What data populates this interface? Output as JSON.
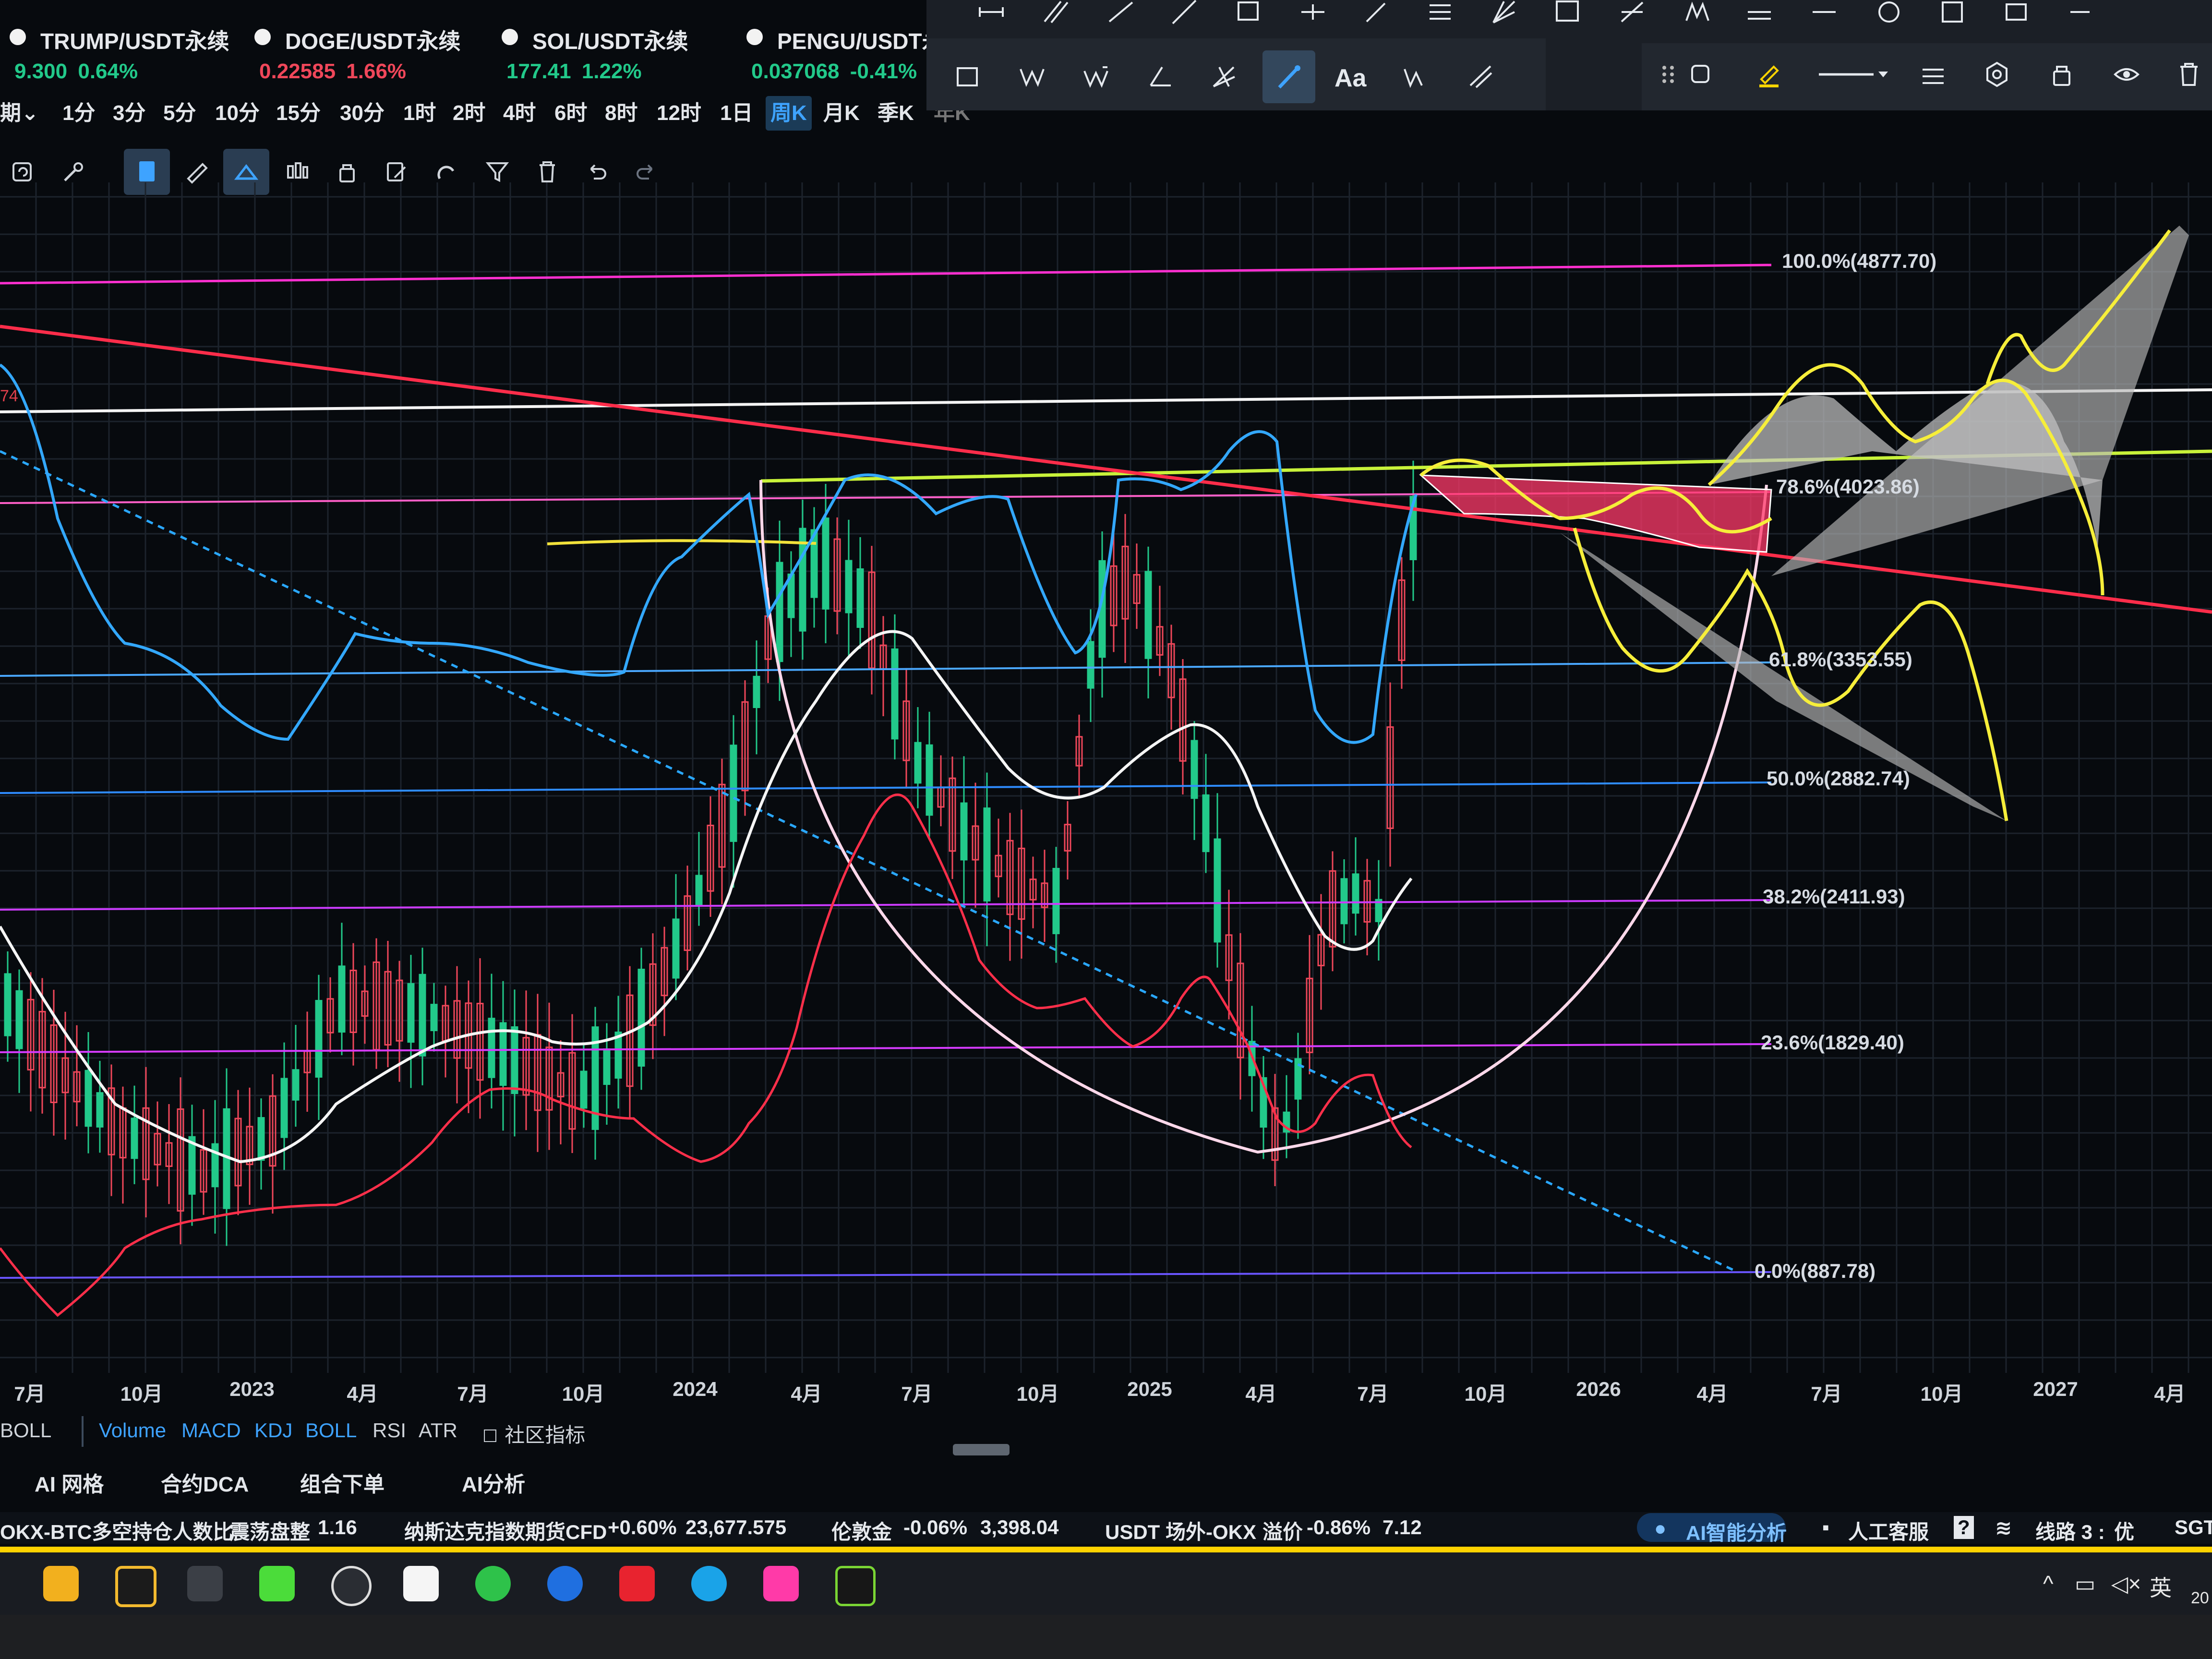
{
  "tickers": [
    {
      "name": "TRUMP/USDT永续",
      "price": "9.300",
      "change": "0.64%",
      "dir": "up"
    },
    {
      "name": "DOGE/USDT永续",
      "price": "0.22585",
      "change": "1.66%",
      "dir": "down"
    },
    {
      "name": "SOL/USDT永续",
      "price": "177.41",
      "change": "1.22%",
      "dir": "up"
    },
    {
      "name": "PENGU/USDT永",
      "price": "0.037068",
      "change": "-0.41%",
      "dir": "up"
    }
  ],
  "timeframes": [
    "期⌄",
    "1分",
    "3分",
    "5分",
    "10分",
    "15分",
    "30分",
    "1时",
    "2时",
    "4时",
    "6时",
    "8时",
    "12时",
    "1日",
    "周K",
    "月K",
    "季K",
    "年K"
  ],
  "active_timeframe": "周K",
  "corner_value": "74",
  "fib_levels": [
    {
      "label": "100.0%(4877.70)",
      "color": "#ff2fd0"
    },
    {
      "label": "78.6%(4023.86)",
      "color": "#ff5fc8"
    },
    {
      "label": "61.8%(3353.55)",
      "color": "#4aa8ff"
    },
    {
      "label": "50.0%(2882.74)",
      "color": "#2f8cff"
    },
    {
      "label": "38.2%(2411.93)",
      "color": "#cc3bff"
    },
    {
      "label": "23.6%(1829.40)",
      "color": "#d63bff"
    },
    {
      "label": "0.0%(887.78)",
      "color": "#6a55ff"
    }
  ],
  "x_axis": [
    "7月",
    "10月",
    "2023",
    "4月",
    "7月",
    "10月",
    "2024",
    "4月",
    "7月",
    "10月",
    "2025",
    "4月",
    "7月",
    "10月",
    "2026",
    "4月",
    "7月",
    "10月",
    "2027",
    "4月"
  ],
  "indicators": {
    "current": "BOLL",
    "tabs": [
      "Volume",
      "MACD",
      "KDJ",
      "BOLL",
      "RSI",
      "ATR"
    ],
    "community": "社区指标"
  },
  "features": [
    "AI 网格",
    "合约DCA",
    "组合下单",
    "AI分析"
  ],
  "status": {
    "ratio_label": "OKX-BTC多空持仓人数比",
    "ratio_state": "震荡盘整",
    "ratio_value": "1.16",
    "nasdaq_label": "纳斯达克指数期货CFD",
    "nasdaq_change": "+0.60%",
    "nasdaq_value": "23,677.575",
    "gold_label": "伦敦金",
    "gold_change": "-0.06%",
    "gold_value": "3,398.04",
    "usdt_label": "USDT 场外-OKX",
    "usdt_tag": "溢价",
    "usdt_change": "-0.86%",
    "usdt_value": "7.12",
    "ai_button": "AI智能分析",
    "service": "人工客服",
    "help": "?",
    "line": "线路 3 :",
    "line_quality": "优",
    "region": "SGT"
  },
  "tray": {
    "caret": "^",
    "ime": "英",
    "clock": "20"
  },
  "colors": {
    "up": "#22c98a",
    "down": "#f0475a",
    "accent": "#3ea3ff"
  }
}
